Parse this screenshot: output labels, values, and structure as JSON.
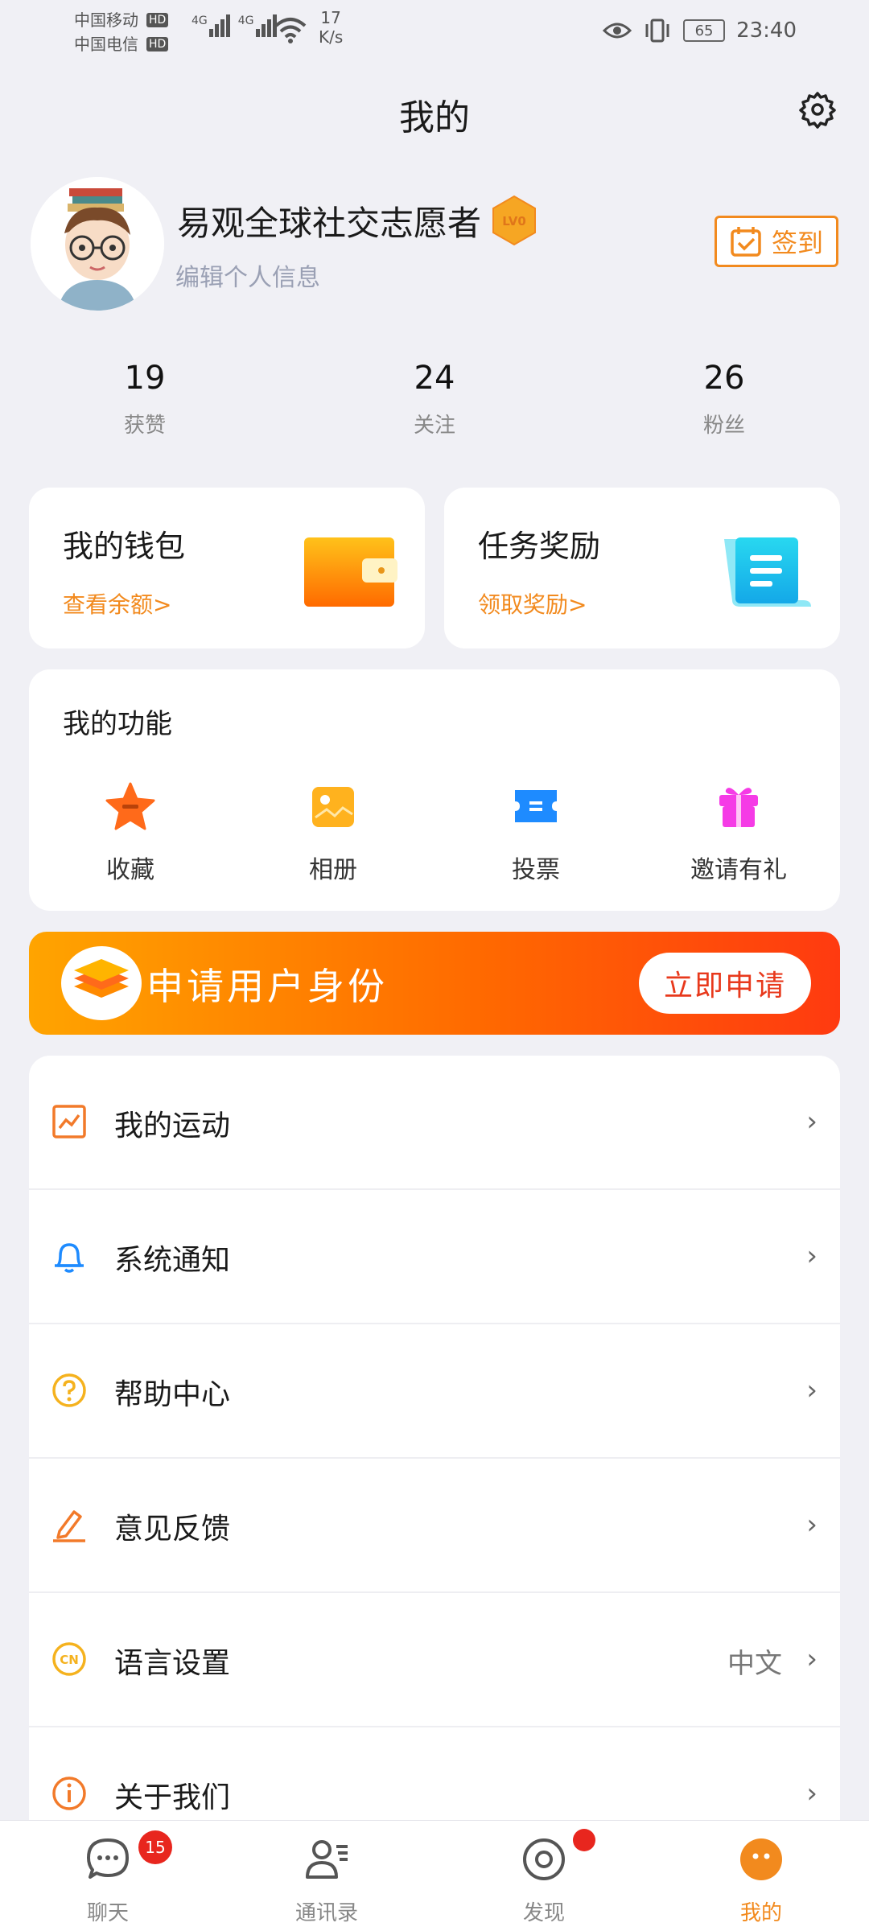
{
  "status_bar": {
    "carrier1": "中国移动",
    "carrier2": "中国电信",
    "hd": "HD",
    "network1": "4G",
    "network2": "4G",
    "net_speed_value": "17",
    "net_speed_unit": "K/s",
    "battery": "65",
    "time": "23:40"
  },
  "header": {
    "title": "我的",
    "settings_icon": "gear-icon"
  },
  "profile": {
    "name": "易观全球社交志愿者",
    "level": "LV0",
    "edit_label": "编辑个人信息",
    "checkin_label": "签到"
  },
  "stats": [
    {
      "value": "19",
      "label": "获赞"
    },
    {
      "value": "24",
      "label": "关注"
    },
    {
      "value": "26",
      "label": "粉丝"
    }
  ],
  "wallet": {
    "title": "我的钱包",
    "link": "查看余额>"
  },
  "tasks": {
    "title": "任务奖励",
    "link": "领取奖励>"
  },
  "functions": {
    "title": "我的功能",
    "items": [
      {
        "label": "收藏",
        "icon": "star-icon",
        "color": "#FF6A1A"
      },
      {
        "label": "相册",
        "icon": "image-icon",
        "color": "#FFB21E"
      },
      {
        "label": "投票",
        "icon": "ticket-icon",
        "color": "#1E8BFF"
      },
      {
        "label": "邀请有礼",
        "icon": "gift-icon",
        "color": "#F53BE6"
      }
    ]
  },
  "banner": {
    "text": "申请用户身份",
    "button": "立即申请"
  },
  "menu": [
    {
      "label": "我的运动",
      "value": "",
      "icon": "chart-icon",
      "color": "#F27A2A"
    },
    {
      "label": "系统通知",
      "value": "",
      "icon": "bell-icon",
      "color": "#1E8BFF"
    },
    {
      "label": "帮助中心",
      "value": "",
      "icon": "question-icon",
      "color": "#F5B21E"
    },
    {
      "label": "意见反馈",
      "value": "",
      "icon": "pen-icon",
      "color": "#F27A2A"
    },
    {
      "label": "语言设置",
      "value": "中文",
      "icon": "cn-icon",
      "color": "#F5B21E"
    },
    {
      "label": "关于我们",
      "value": "",
      "icon": "info-icon",
      "color": "#F27A2A"
    }
  ],
  "chevron": "›",
  "nav": [
    {
      "label": "聊天",
      "icon": "chat-icon",
      "badge": "15"
    },
    {
      "label": "通讯录",
      "icon": "contacts-icon",
      "badge": ""
    },
    {
      "label": "发现",
      "icon": "discover-icon",
      "badge": ""
    },
    {
      "label": "我的",
      "icon": "me-icon",
      "badge": ""
    }
  ],
  "colors": {
    "accent": "#F28A1E",
    "badge_red": "#E8261E"
  }
}
